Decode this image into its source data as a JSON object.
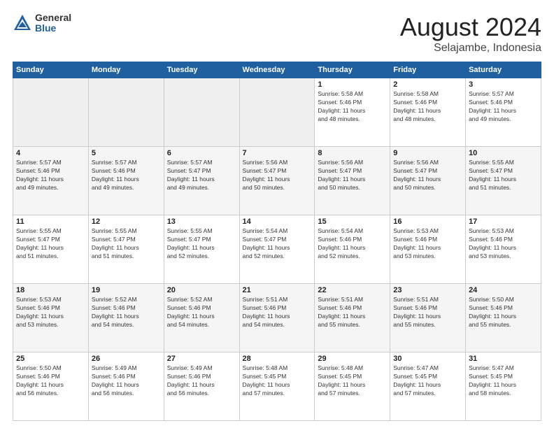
{
  "header": {
    "logo_line1": "General",
    "logo_line2": "Blue",
    "month_title": "August 2024",
    "location": "Selajambe, Indonesia"
  },
  "weekdays": [
    "Sunday",
    "Monday",
    "Tuesday",
    "Wednesday",
    "Thursday",
    "Friday",
    "Saturday"
  ],
  "weeks": [
    [
      {
        "day": "",
        "info": ""
      },
      {
        "day": "",
        "info": ""
      },
      {
        "day": "",
        "info": ""
      },
      {
        "day": "",
        "info": ""
      },
      {
        "day": "1",
        "info": "Sunrise: 5:58 AM\nSunset: 5:46 PM\nDaylight: 11 hours\nand 48 minutes."
      },
      {
        "day": "2",
        "info": "Sunrise: 5:58 AM\nSunset: 5:46 PM\nDaylight: 11 hours\nand 48 minutes."
      },
      {
        "day": "3",
        "info": "Sunrise: 5:57 AM\nSunset: 5:46 PM\nDaylight: 11 hours\nand 49 minutes."
      }
    ],
    [
      {
        "day": "4",
        "info": "Sunrise: 5:57 AM\nSunset: 5:46 PM\nDaylight: 11 hours\nand 49 minutes."
      },
      {
        "day": "5",
        "info": "Sunrise: 5:57 AM\nSunset: 5:46 PM\nDaylight: 11 hours\nand 49 minutes."
      },
      {
        "day": "6",
        "info": "Sunrise: 5:57 AM\nSunset: 5:47 PM\nDaylight: 11 hours\nand 49 minutes."
      },
      {
        "day": "7",
        "info": "Sunrise: 5:56 AM\nSunset: 5:47 PM\nDaylight: 11 hours\nand 50 minutes."
      },
      {
        "day": "8",
        "info": "Sunrise: 5:56 AM\nSunset: 5:47 PM\nDaylight: 11 hours\nand 50 minutes."
      },
      {
        "day": "9",
        "info": "Sunrise: 5:56 AM\nSunset: 5:47 PM\nDaylight: 11 hours\nand 50 minutes."
      },
      {
        "day": "10",
        "info": "Sunrise: 5:55 AM\nSunset: 5:47 PM\nDaylight: 11 hours\nand 51 minutes."
      }
    ],
    [
      {
        "day": "11",
        "info": "Sunrise: 5:55 AM\nSunset: 5:47 PM\nDaylight: 11 hours\nand 51 minutes."
      },
      {
        "day": "12",
        "info": "Sunrise: 5:55 AM\nSunset: 5:47 PM\nDaylight: 11 hours\nand 51 minutes."
      },
      {
        "day": "13",
        "info": "Sunrise: 5:55 AM\nSunset: 5:47 PM\nDaylight: 11 hours\nand 52 minutes."
      },
      {
        "day": "14",
        "info": "Sunrise: 5:54 AM\nSunset: 5:47 PM\nDaylight: 11 hours\nand 52 minutes."
      },
      {
        "day": "15",
        "info": "Sunrise: 5:54 AM\nSunset: 5:46 PM\nDaylight: 11 hours\nand 52 minutes."
      },
      {
        "day": "16",
        "info": "Sunrise: 5:53 AM\nSunset: 5:46 PM\nDaylight: 11 hours\nand 53 minutes."
      },
      {
        "day": "17",
        "info": "Sunrise: 5:53 AM\nSunset: 5:46 PM\nDaylight: 11 hours\nand 53 minutes."
      }
    ],
    [
      {
        "day": "18",
        "info": "Sunrise: 5:53 AM\nSunset: 5:46 PM\nDaylight: 11 hours\nand 53 minutes."
      },
      {
        "day": "19",
        "info": "Sunrise: 5:52 AM\nSunset: 5:46 PM\nDaylight: 11 hours\nand 54 minutes."
      },
      {
        "day": "20",
        "info": "Sunrise: 5:52 AM\nSunset: 5:46 PM\nDaylight: 11 hours\nand 54 minutes."
      },
      {
        "day": "21",
        "info": "Sunrise: 5:51 AM\nSunset: 5:46 PM\nDaylight: 11 hours\nand 54 minutes."
      },
      {
        "day": "22",
        "info": "Sunrise: 5:51 AM\nSunset: 5:46 PM\nDaylight: 11 hours\nand 55 minutes."
      },
      {
        "day": "23",
        "info": "Sunrise: 5:51 AM\nSunset: 5:46 PM\nDaylight: 11 hours\nand 55 minutes."
      },
      {
        "day": "24",
        "info": "Sunrise: 5:50 AM\nSunset: 5:46 PM\nDaylight: 11 hours\nand 55 minutes."
      }
    ],
    [
      {
        "day": "25",
        "info": "Sunrise: 5:50 AM\nSunset: 5:46 PM\nDaylight: 11 hours\nand 56 minutes."
      },
      {
        "day": "26",
        "info": "Sunrise: 5:49 AM\nSunset: 5:46 PM\nDaylight: 11 hours\nand 56 minutes."
      },
      {
        "day": "27",
        "info": "Sunrise: 5:49 AM\nSunset: 5:46 PM\nDaylight: 11 hours\nand 56 minutes."
      },
      {
        "day": "28",
        "info": "Sunrise: 5:48 AM\nSunset: 5:45 PM\nDaylight: 11 hours\nand 57 minutes."
      },
      {
        "day": "29",
        "info": "Sunrise: 5:48 AM\nSunset: 5:45 PM\nDaylight: 11 hours\nand 57 minutes."
      },
      {
        "day": "30",
        "info": "Sunrise: 5:47 AM\nSunset: 5:45 PM\nDaylight: 11 hours\nand 57 minutes."
      },
      {
        "day": "31",
        "info": "Sunrise: 5:47 AM\nSunset: 5:45 PM\nDaylight: 11 hours\nand 58 minutes."
      }
    ]
  ]
}
